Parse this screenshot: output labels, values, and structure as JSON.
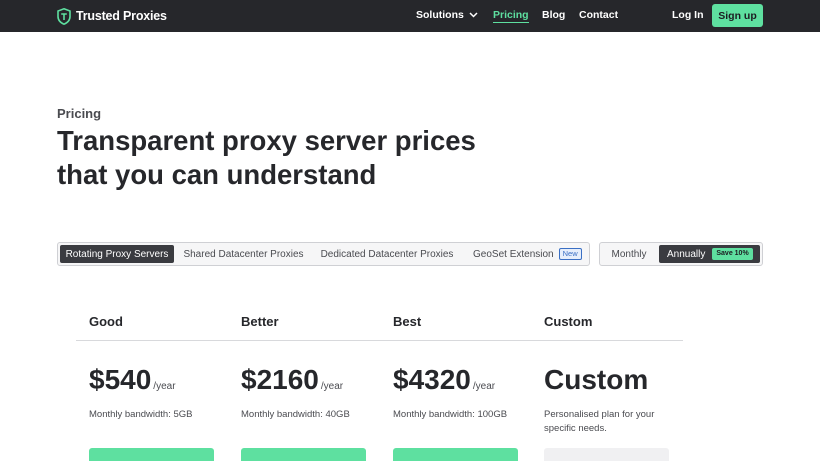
{
  "brand": {
    "name": "Trusted Proxies",
    "accent": "#5ee0a0",
    "dark": "#26272b"
  },
  "nav": {
    "solutions": "Solutions",
    "pricing": "Pricing",
    "blog": "Blog",
    "contact": "Contact",
    "login": "Log In",
    "signup": "Sign up"
  },
  "hero": {
    "eyebrow": "Pricing",
    "headline_line1": "Transparent proxy server prices",
    "headline_line2": "that you can understand"
  },
  "product_tabs": [
    {
      "label": "Rotating Proxy Servers",
      "active": true
    },
    {
      "label": "Shared Datacenter Proxies",
      "active": false
    },
    {
      "label": "Dedicated Datacenter Proxies",
      "active": false
    },
    {
      "label": "GeoSet Extension",
      "badge": "New",
      "active": false
    }
  ],
  "billing_tabs": [
    {
      "label": "Monthly",
      "active": false
    },
    {
      "label": "Annually",
      "badge": "Save 10%",
      "active": true
    }
  ],
  "plans": [
    {
      "name": "Good",
      "price": "$540",
      "period": "/year",
      "detail": "Monthly bandwidth: 5GB"
    },
    {
      "name": "Better",
      "price": "$2160",
      "period": "/year",
      "detail": "Monthly bandwidth: 40GB"
    },
    {
      "name": "Best",
      "price": "$4320",
      "period": "/year",
      "detail": "Monthly bandwidth: 100GB"
    },
    {
      "name": "Custom",
      "price": "Custom",
      "period": "",
      "detail": "Personalised plan for your specific needs."
    }
  ]
}
